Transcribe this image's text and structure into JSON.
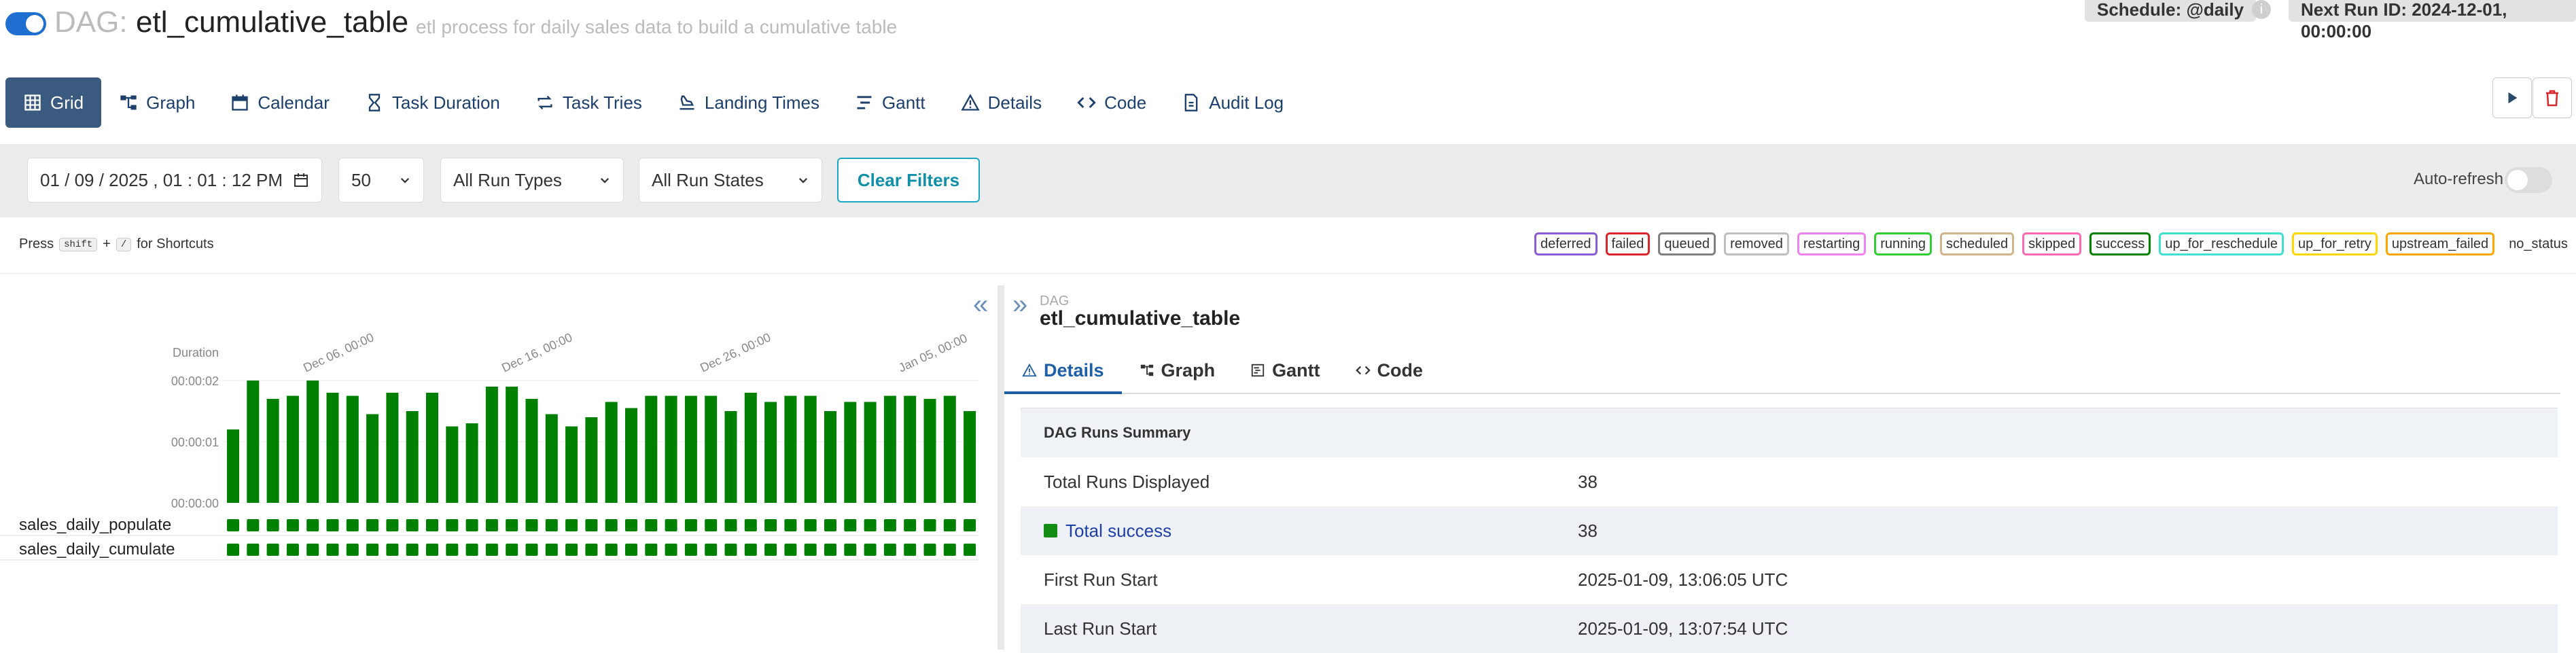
{
  "header": {
    "prefix": "DAG:",
    "dag_id": "etl_cumulative_table",
    "description": "etl process for daily sales data to build a cumulative table",
    "schedule": "Schedule: @daily",
    "info_icon": "i",
    "next_run": "Next Run ID: 2024-12-01, 00:00:00"
  },
  "nav": {
    "tabs": [
      {
        "label": "Grid",
        "icon": "grid-icon"
      },
      {
        "label": "Graph",
        "icon": "graph-icon"
      },
      {
        "label": "Calendar",
        "icon": "calendar-icon"
      },
      {
        "label": "Task Duration",
        "icon": "hourglass-icon"
      },
      {
        "label": "Task Tries",
        "icon": "retry-icon"
      },
      {
        "label": "Landing Times",
        "icon": "landing-icon"
      },
      {
        "label": "Gantt",
        "icon": "gantt-icon"
      },
      {
        "label": "Details",
        "icon": "warning-triangle-icon"
      },
      {
        "label": "Code",
        "icon": "code-icon"
      },
      {
        "label": "Audit Log",
        "icon": "document-icon"
      }
    ],
    "active": "Grid"
  },
  "filters": {
    "date": "01 / 09 / 2025 ,  01 : 01 : 12   PM",
    "count": "50",
    "run_types": "All Run Types",
    "run_states": "All Run States",
    "clear": "Clear Filters",
    "auto_refresh": "Auto-refresh"
  },
  "shortcut": {
    "press": "Press",
    "key1": "shift",
    "plus": "+",
    "key2": "/",
    "suffix": "for Shortcuts"
  },
  "states": [
    {
      "label": "deferred",
      "color": "#8a5cd6"
    },
    {
      "label": "failed",
      "color": "#d9262c"
    },
    {
      "label": "queued",
      "color": "#808080"
    },
    {
      "label": "removed",
      "color": "#bfbfbf"
    },
    {
      "label": "restarting",
      "color": "#ee82ee"
    },
    {
      "label": "running",
      "color": "#32cd32"
    },
    {
      "label": "scheduled",
      "color": "#d2b48c"
    },
    {
      "label": "skipped",
      "color": "#ff69b4"
    },
    {
      "label": "success",
      "color": "#008000"
    },
    {
      "label": "up_for_reschedule",
      "color": "#40e0d0"
    },
    {
      "label": "up_for_retry",
      "color": "#ffd700"
    },
    {
      "label": "upstream_failed",
      "color": "#ffa500"
    },
    {
      "label": "no_status",
      "color": ""
    }
  ],
  "chart_data": {
    "type": "bar",
    "ylabel": "Duration",
    "y_ticks": [
      "00:00:02",
      "00:00:01",
      "00:00:00"
    ],
    "ylim": [
      0,
      2
    ],
    "date_labels": [
      "Dec 06, 00:00",
      "Dec 16, 00:00",
      "Dec 26, 00:00",
      "Jan 05, 00:00"
    ],
    "values": [
      1.2,
      2.0,
      1.7,
      1.75,
      2.0,
      1.8,
      1.75,
      1.45,
      1.8,
      1.5,
      1.8,
      1.25,
      1.3,
      1.9,
      1.9,
      1.7,
      1.45,
      1.25,
      1.4,
      1.65,
      1.55,
      1.75,
      1.75,
      1.75,
      1.75,
      1.5,
      1.8,
      1.65,
      1.75,
      1.75,
      1.5,
      1.65,
      1.65,
      1.75,
      1.75,
      1.7,
      1.75,
      1.5
    ],
    "bar_color": "#008000"
  },
  "tasks": [
    "sales_daily_populate",
    "sales_daily_cumulate"
  ],
  "details": {
    "dag_label": "DAG",
    "dag_name": "etl_cumulative_table",
    "tabs": [
      "Details",
      "Graph",
      "Gantt",
      "Code"
    ],
    "summary_title": "DAG Runs Summary",
    "rows": [
      {
        "key": "Total Runs Displayed",
        "value": "38"
      },
      {
        "key": "Total success",
        "value": "38"
      },
      {
        "key": "First Run Start",
        "value": "2025-01-09, 13:06:05 UTC"
      },
      {
        "key": "Last Run Start",
        "value": "2025-01-09, 13:07:54 UTC"
      }
    ]
  }
}
